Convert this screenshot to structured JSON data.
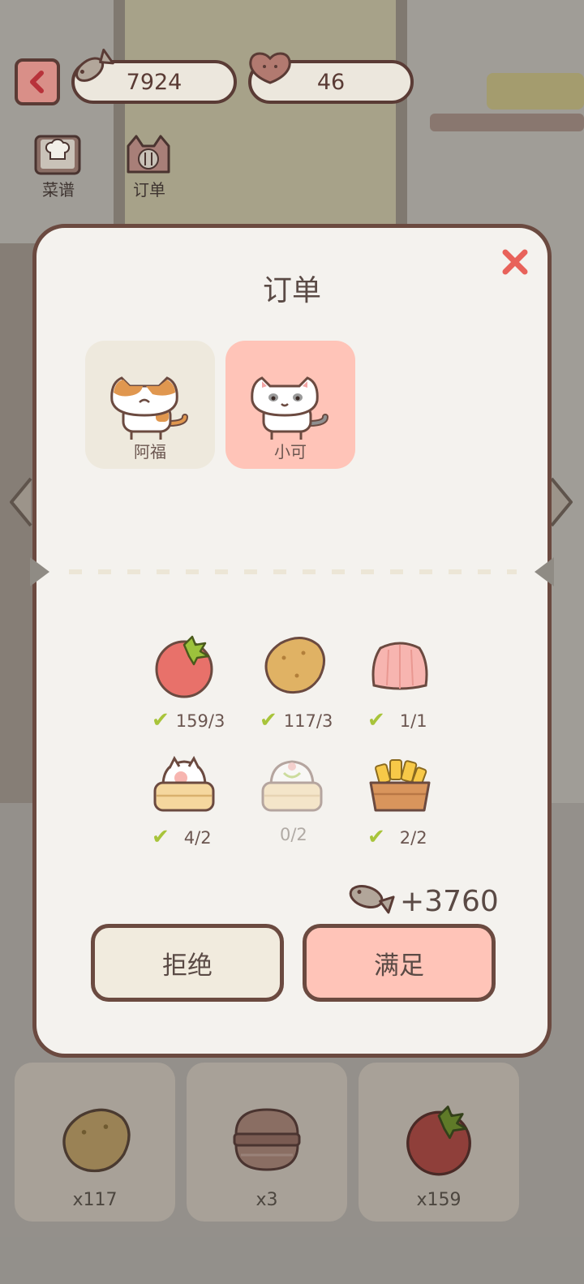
{
  "hud": {
    "fish_currency": "7924",
    "hearts": "46"
  },
  "shortcuts": [
    {
      "label": "菜谱"
    },
    {
      "label": "订单"
    }
  ],
  "modal": {
    "title": "订单",
    "customers": [
      {
        "name": "阿福",
        "selected": false
      },
      {
        "name": "小可",
        "selected": true
      }
    ],
    "ingredients": [
      {
        "icon": "tomato-icon",
        "count": "159/3",
        "fulfilled": true
      },
      {
        "icon": "potato-icon",
        "count": "117/3",
        "fulfilled": true
      },
      {
        "icon": "jelly-icon",
        "count": "1/1",
        "fulfilled": true
      },
      {
        "icon": "cat-bun-steamer-icon",
        "count": "4/2",
        "fulfilled": true
      },
      {
        "icon": "dumpling-steamer-icon",
        "count": "0/2",
        "fulfilled": false
      },
      {
        "icon": "fries-basket-icon",
        "count": "2/2",
        "fulfilled": true
      }
    ],
    "reward": "+3760",
    "reject_label": "拒绝",
    "accept_label": "满足"
  },
  "inventory": [
    {
      "icon": "potato-icon",
      "count": "x117"
    },
    {
      "icon": "burger-icon",
      "count": "x3"
    },
    {
      "icon": "tomato-icon",
      "count": "x159"
    }
  ],
  "colors": {
    "accent": "#ffc4b8",
    "outline": "#6b4a40",
    "check": "#a8c43a",
    "close": "#e8625a"
  }
}
